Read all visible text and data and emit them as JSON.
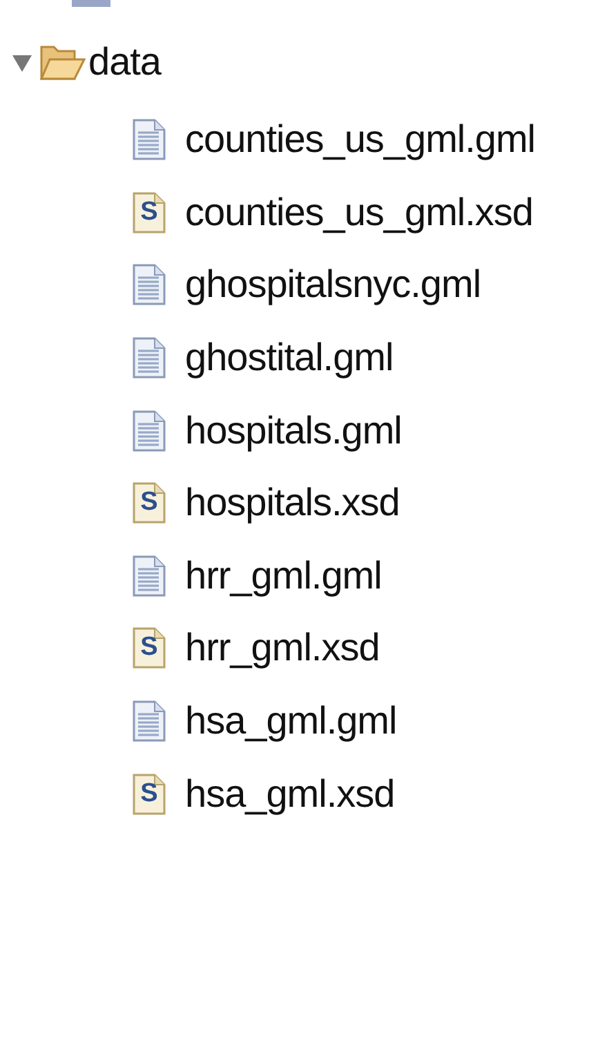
{
  "tree": {
    "label": "data",
    "expanded": true,
    "children": [
      {
        "label": "counties_us_gml.gml",
        "kind": "document"
      },
      {
        "label": "counties_us_gml.xsd",
        "kind": "schema",
        "icon_letter": "S"
      },
      {
        "label": "ghospitalsnyc.gml",
        "kind": "document"
      },
      {
        "label": "ghostital.gml",
        "kind": "document"
      },
      {
        "label": "hospitals.gml",
        "kind": "document"
      },
      {
        "label": "hospitals.xsd",
        "kind": "schema",
        "icon_letter": "S"
      },
      {
        "label": "hrr_gml.gml",
        "kind": "document"
      },
      {
        "label": "hrr_gml.xsd",
        "kind": "schema",
        "icon_letter": "S"
      },
      {
        "label": "hsa_gml.gml",
        "kind": "document"
      },
      {
        "label": "hsa_gml.xsd",
        "kind": "schema",
        "icon_letter": "S"
      }
    ]
  }
}
